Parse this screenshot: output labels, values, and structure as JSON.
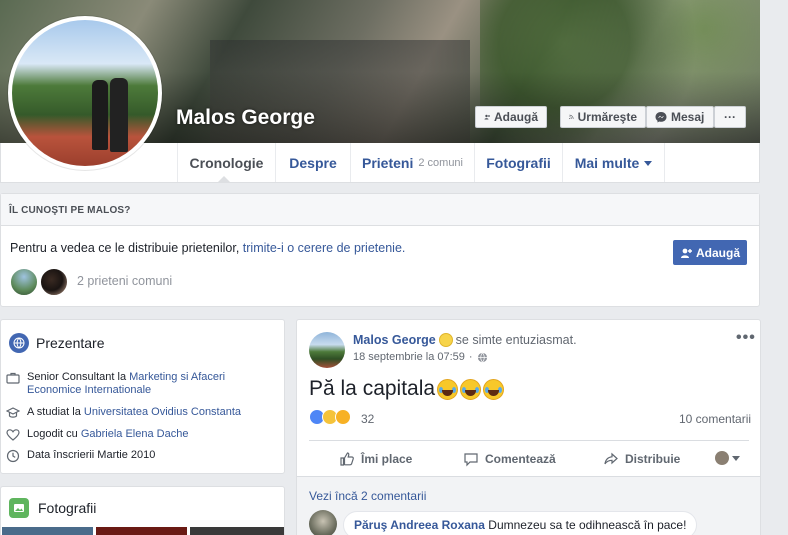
{
  "profile": {
    "name": "Malos George",
    "buttons": {
      "add": "Adaugă",
      "follow": "Urmăreşte",
      "message": "Mesaj",
      "more": "···"
    }
  },
  "nav": {
    "tabs": [
      {
        "label": "Cronologie"
      },
      {
        "label": "Despre"
      },
      {
        "label": "Prieteni",
        "count": "2 comuni"
      },
      {
        "label": "Fotografii"
      },
      {
        "label": "Mai multe"
      }
    ]
  },
  "know_box": {
    "heading": "ÎL CUNOŞTI PE MALOS?",
    "text": "Pentru a vedea ce le distribuie prietenilor,",
    "link": "trimite-i o cerere de prietenie.",
    "add_button": "Adaugă",
    "mutual": "2 prieteni comuni"
  },
  "intro": {
    "heading": "Prezentare",
    "rows": [
      {
        "icon": "briefcase-icon",
        "prefix": "Senior Consultant la",
        "link": "Marketing si Afaceri Economice Internationale"
      },
      {
        "icon": "graduation-cap-icon",
        "prefix": "A studiat la",
        "link": "Universitatea Ovidius Constanta"
      },
      {
        "icon": "heart-icon",
        "prefix": "Logodit cu",
        "link": "Gabriela Elena Dache"
      },
      {
        "icon": "clock-icon",
        "prefix": "Data înscrierii Martie 2010",
        "link": ""
      }
    ]
  },
  "photos": {
    "heading": "Fotografii"
  },
  "post": {
    "author": "Malos George",
    "feeling": "se simte entuziasmat.",
    "date": "18 septembrie la 07:59",
    "text": "Pă la capitala",
    "reaction_count": "32",
    "comment_count": "10 comentarii",
    "actions": {
      "like": "Îmi place",
      "comment": "Comentează",
      "share": "Distribuie"
    },
    "view_more": "Vezi încă 2 comentarii",
    "comment": {
      "author": "Păruş Andreea Roxana",
      "text": "Dumnezeu sa te odihnească în pace!"
    }
  },
  "colors": {
    "brand": "#4267b2",
    "link": "#365899",
    "background": "#e9ebee"
  }
}
